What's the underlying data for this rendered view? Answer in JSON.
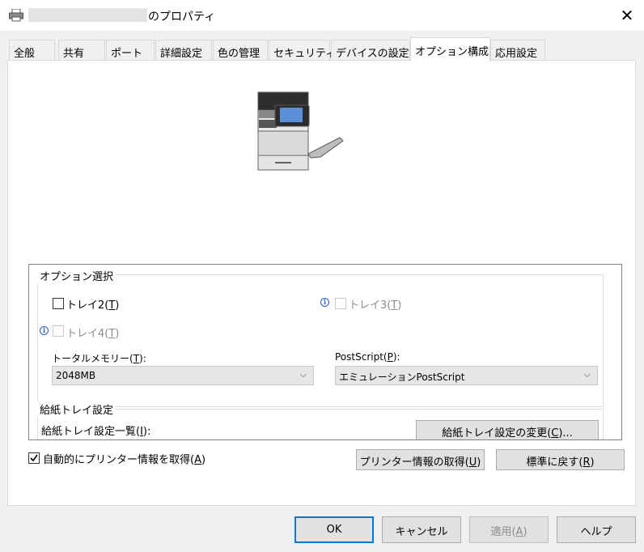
{
  "window": {
    "title_suffix": "のプロパティ",
    "close_glyph": "✕"
  },
  "tabs": [
    {
      "label": "全般"
    },
    {
      "label": "共有"
    },
    {
      "label": "ポート"
    },
    {
      "label": "詳細設定"
    },
    {
      "label": "色の管理"
    },
    {
      "label": "セキュリティ"
    },
    {
      "label": "デバイスの設定"
    },
    {
      "label": "オプション構成",
      "active": true
    },
    {
      "label": "応用設定"
    }
  ],
  "options": {
    "group_title": "オプション選択",
    "tray2": {
      "label": "トレイ2(",
      "key": "T",
      "close": ")",
      "checked": false,
      "enabled": true
    },
    "tray3": {
      "label": "トレイ3(",
      "key": "T",
      "close": ")",
      "checked": false,
      "enabled": false
    },
    "tray4": {
      "label": "トレイ4(",
      "key": "T",
      "close": ")",
      "checked": false,
      "enabled": false
    },
    "info_glyph": "i",
    "memory": {
      "label": "トータルメモリー(",
      "key": "T",
      "close": "):",
      "value": "2048MB"
    },
    "postscript": {
      "label": "PostScript(",
      "key": "P",
      "close": "):",
      "value": "エミュレーションPostScript"
    }
  },
  "paper_tray": {
    "group_title": "給紙トレイ設定",
    "list_label": "給紙トレイ設定一覧(",
    "list_key": "I",
    "list_close": "):",
    "change_button": "給紙トレイ設定の変更(",
    "change_key": "C",
    "change_close": ")..."
  },
  "auto_get": {
    "label": "自動的にプリンター情報を取得(",
    "key": "A",
    "close": ")",
    "checked": true
  },
  "buttons": {
    "get_info": {
      "label": "プリンター情報の取得(",
      "key": "U",
      "close": ")"
    },
    "reset": {
      "label": "標準に戻す(",
      "key": "R",
      "close": ")"
    },
    "ok": "OK",
    "cancel": "キャンセル",
    "apply": {
      "label": "適用(",
      "key": "A",
      "close": ")"
    },
    "help": "ヘルプ"
  },
  "scroll": {
    "up_glyph": "˄",
    "down_glyph": "˅"
  },
  "chevron_glyph": "⌵"
}
